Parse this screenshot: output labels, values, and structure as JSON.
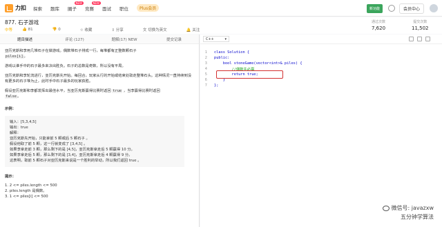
{
  "topbar": {
    "logo": "力扣",
    "nav": [
      "探索",
      "题库",
      "圈子",
      "竞赛",
      "面试",
      "职位"
    ],
    "badge_new": "NEW",
    "badge_label": "NEW",
    "plus": "Plus会员",
    "new_label": "新功能",
    "member": "会员中心"
  },
  "problem": {
    "title": "877. 石子游戏",
    "difficulty": "中等",
    "likes": "81",
    "dislikes": "0",
    "favorite": "收藏",
    "share": "分享",
    "switch_lang": "切换为英文",
    "follow": "关注",
    "pass_label": "通过次数",
    "pass_count": "7,620",
    "submit_label": "提交次数",
    "submit_count": "11,502"
  },
  "tabs": [
    "题目描述",
    "评论 (127)",
    "题解(17) NEW",
    "提交记录"
  ],
  "description": {
    "p1": "亚历克斯和李用几堆石子在做游戏。偶数堆石子排成一行，每堆都有正整数颗石子",
    "p1b": "piles[i]",
    "p1c": "。",
    "p2": "游戏以谁手中的石子最多来决出胜负。石子的总数是奇数，所以没有平局。",
    "p3": "亚历克斯和李轮流进行，亚历克斯先开始。每回合，玩家从行的开始或结束处取走整堆石头。这种情况一直持续到没有更多的石子堆为止，此时手中石子最多的玩家获胜。",
    "p4a": "假设亚历克斯和李都发挥出最佳水平，当亚历克斯赢得比赛时返回",
    "p4b": "true",
    "p4c": "，当李赢得比赛时返回",
    "p4d": "false",
    "p4e": "。",
    "example_title": "示例：",
    "example_lines": [
      "输入：[5,3,4,5]",
      "输出：true",
      "解释：",
      "亚历克斯先开始，只能拿前 5 颗或后 5 颗石子 。",
      "假设他取了前 5 颗，这一行就变成了 [3,4,5] 。",
      "如果李拿走前 3 颗，那么剩下的是 [4,5]，亚历克斯拿走后 5 颗赢得 10 分。",
      "如果李拿走后 5 颗，那么剩下的是 [3,4]，亚历克斯拿走后 4 颗赢得 9 分。",
      "这表明，取前 5 颗石子对亚历克斯来说是一个胜利的举动，所以我们返回 true 。"
    ],
    "tips_title": "提示：",
    "tips": [
      "1. 2 <= piles.length <= 500",
      "2. piles.length 是偶数。",
      "3. 1 <= piles[i] <= 500"
    ]
  },
  "editor": {
    "language": "C++",
    "lines": [
      {
        "n": "1",
        "text": "class Solution {"
      },
      {
        "n": "2",
        "text": "public:"
      },
      {
        "n": "3",
        "text": "    bool stoneGame(vector<int>& piles) {"
      },
      {
        "n": "4",
        "text": "        //偶数先必赢"
      },
      {
        "n": "5",
        "text": "        return true;"
      },
      {
        "n": "6",
        "text": "    }"
      },
      {
        "n": "7",
        "text": "};"
      }
    ]
  },
  "watermark": {
    "line1": "微信号: javazxw",
    "line2": "五分钟学算法"
  }
}
